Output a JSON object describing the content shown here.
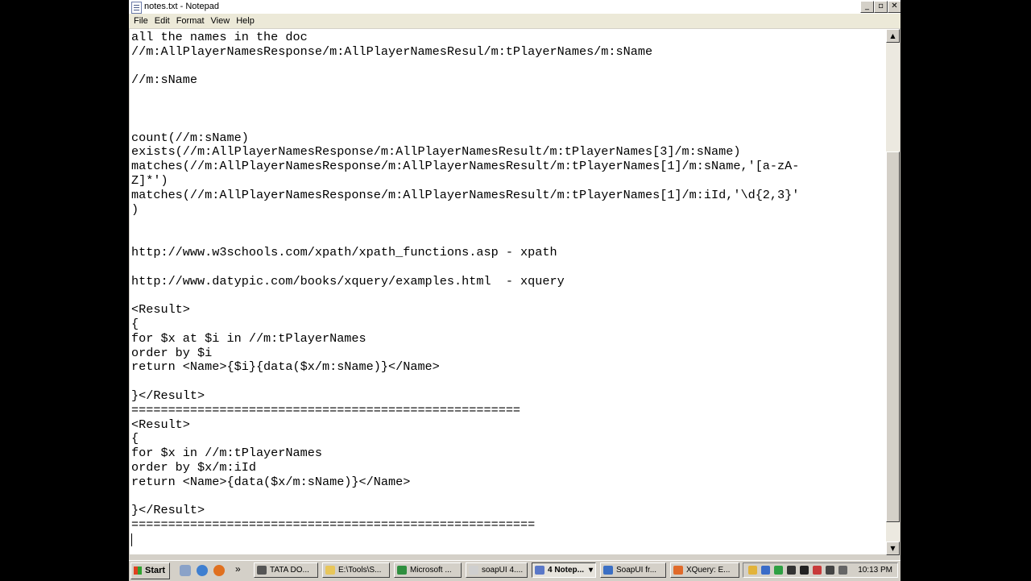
{
  "window": {
    "title": "notes.txt - Notepad",
    "controls": {
      "minimize": "_",
      "maximize": "▫",
      "close": "✕"
    }
  },
  "menu": {
    "items": [
      "File",
      "Edit",
      "Format",
      "View",
      "Help"
    ]
  },
  "editor": {
    "lines": [
      "all the names in the doc",
      "//m:AllPlayerNamesResponse/m:AllPlayerNamesResul/m:tPlayerNames/m:sName",
      "",
      "//m:sName",
      "",
      "",
      "",
      "count(//m:sName)",
      "exists(//m:AllPlayerNamesResponse/m:AllPlayerNamesResult/m:tPlayerNames[3]/m:sName)",
      "matches(//m:AllPlayerNamesResponse/m:AllPlayerNamesResult/m:tPlayerNames[1]/m:sName,'[a-zA-",
      "Z]*')",
      "matches(//m:AllPlayerNamesResponse/m:AllPlayerNamesResult/m:tPlayerNames[1]/m:iId,'\\d{2,3}'",
      ")",
      "",
      "",
      "http://www.w3schools.com/xpath/xpath_functions.asp - xpath",
      "",
      "http://www.datypic.com/books/xquery/examples.html  - xquery",
      "",
      "<Result>",
      "{",
      "for $x at $i in //m:tPlayerNames",
      "order by $i",
      "return <Name>{$i}{data($x/m:sName)}</Name>",
      "",
      "}</Result>",
      "=====================================================",
      "<Result>",
      "{",
      "for $x in //m:tPlayerNames",
      "order by $x/m:iId",
      "return <Name>{data($x/m:sName)}</Name>",
      "",
      "}</Result>",
      "======================================================="
    ]
  },
  "scrollbar": {
    "up": "▲",
    "down": "▼"
  },
  "taskbar": {
    "start_label": "Start",
    "quicklaunch_more": "»",
    "buttons": [
      {
        "label": "TATA DO...",
        "color": "#555555"
      },
      {
        "label": "E:\\Tools\\S...",
        "color": "#e8c65a"
      },
      {
        "label": "Microsoft ...",
        "color": "#2f8f3f"
      },
      {
        "label": "soapUI 4....",
        "color": "#cfcfcf"
      },
      {
        "label": "4 Notep...",
        "color": "#5a78c8",
        "active": true,
        "menu": "▾"
      },
      {
        "label": "SoapUI fr...",
        "color": "#3b6fc4"
      },
      {
        "label": "XQuery: E...",
        "color": "#e06a2a"
      }
    ],
    "tray_icons": [
      "#e2b33a",
      "#3a6cc8",
      "#2ea043",
      "#333333",
      "#222222",
      "#c83a3a",
      "#444444",
      "#666666"
    ],
    "clock": "10:13 PM"
  }
}
